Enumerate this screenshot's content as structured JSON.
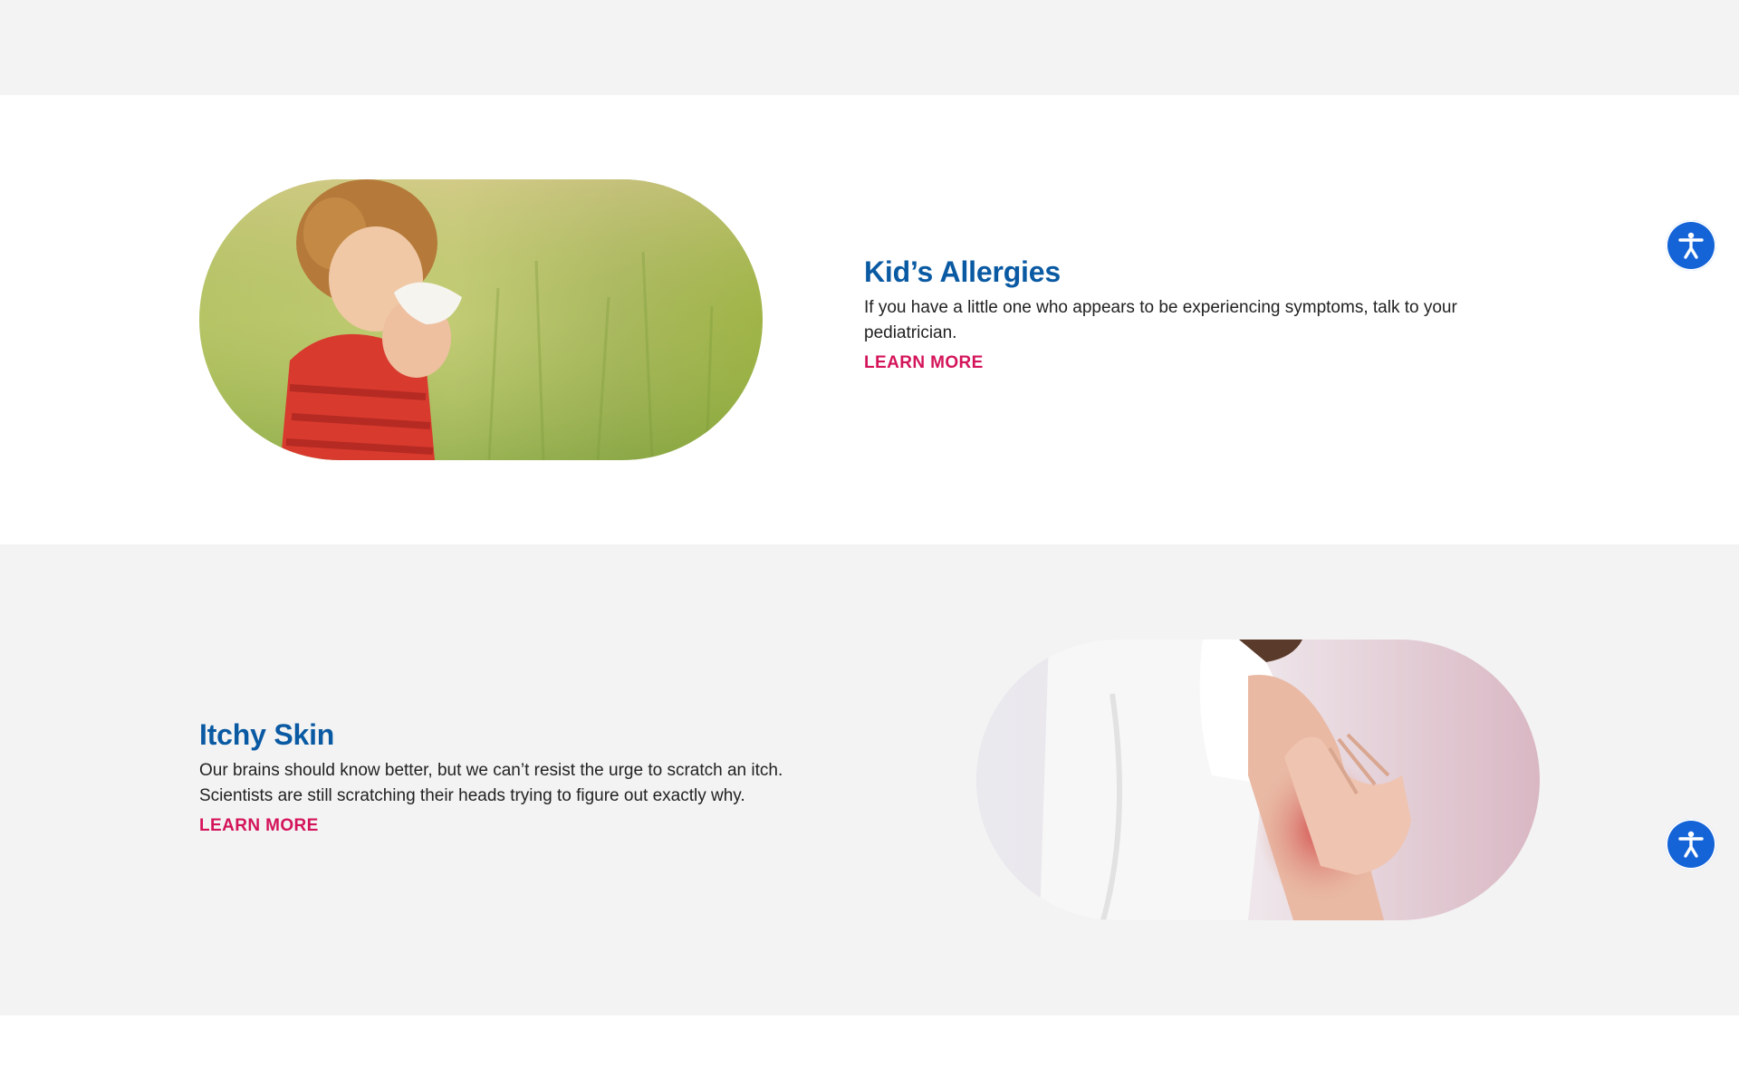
{
  "sections": [
    {
      "title": "Kid’s Allergies",
      "description": "If you have a little one who appears to be experiencing symptoms, talk to your pediatrician.",
      "link_label": "LEARN MORE",
      "image": "child-sneezing-into-tissue-photo"
    },
    {
      "title": "Itchy Skin",
      "description": "Our brains should know better, but we can’t resist the urge to scratch an itch. Scientists are still scratching their heads trying to figure out exactly why.",
      "link_label": "LEARN MORE",
      "image": "person-scratching-arm-photo"
    }
  ],
  "accessibility_widget": {
    "icon": "accessibility-person-icon",
    "color": "#1464d8"
  },
  "colors": {
    "title": "#0a5aa3",
    "link": "#d4145a",
    "band_gray": "#f3f3f3"
  }
}
